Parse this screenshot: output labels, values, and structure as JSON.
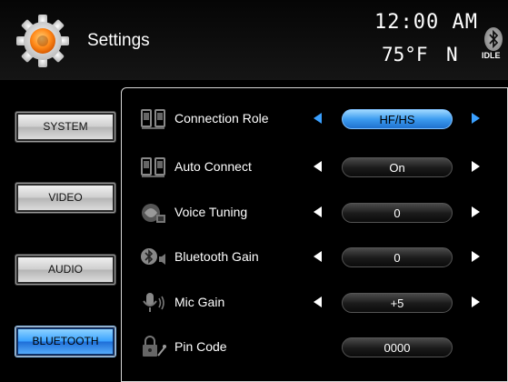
{
  "header": {
    "title": "Settings",
    "time": "12:00 AM",
    "temperature": "75°F",
    "compass": "N",
    "bt_status_label": "IDLE"
  },
  "menu": {
    "items": [
      {
        "label": "SYSTEM",
        "active": false
      },
      {
        "label": "VIDEO",
        "active": false
      },
      {
        "label": "AUDIO",
        "active": false
      },
      {
        "label": "BLUETOOTH",
        "active": true
      }
    ]
  },
  "settings": {
    "rows": [
      {
        "label": "Connection Role",
        "value": "HF/HS",
        "icon": "phone-pair-icon",
        "selected": true,
        "adjustable": true
      },
      {
        "label": "Auto Connect",
        "value": "On",
        "icon": "phone-pair-icon",
        "selected": false,
        "adjustable": true
      },
      {
        "label": "Voice Tuning",
        "value": "0",
        "icon": "voice-tuning-icon",
        "selected": false,
        "adjustable": true
      },
      {
        "label": "Bluetooth Gain",
        "value": "0",
        "icon": "bluetooth-speaker-icon",
        "selected": false,
        "adjustable": true
      },
      {
        "label": "Mic Gain",
        "value": "+5",
        "icon": "microphone-icon",
        "selected": false,
        "adjustable": true
      },
      {
        "label": "Pin Code",
        "value": "0000",
        "icon": "lock-key-icon",
        "selected": false,
        "adjustable": false
      }
    ]
  },
  "colors": {
    "accent": "#3aa0ff",
    "active_button": "#3aa3ff"
  }
}
